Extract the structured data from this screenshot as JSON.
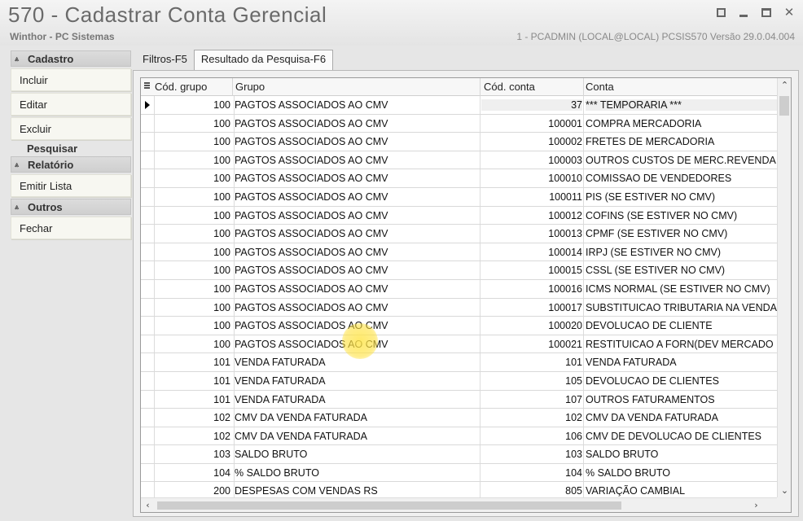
{
  "window": {
    "title": "570 - Cadastrar Conta Gerencial",
    "subtitle": "Winthor - PC Sistemas",
    "session_info": "1 - PCADMIN (LOCAL@LOCAL)   PCSIS570  Versão  29.0.04.004"
  },
  "sidebar": {
    "cadastro_header": "Cadastro",
    "incluir": "Incluir",
    "editar": "Editar",
    "excluir": "Excluir",
    "pesquisar": "Pesquisar",
    "relatorio_header": "Relatório",
    "emitir_lista": "Emitir Lista",
    "outros_header": "Outros",
    "fechar": "Fechar"
  },
  "tabs": {
    "filtros": "Filtros-F5",
    "resultado": "Resultado da Pesquisa-F6"
  },
  "grid": {
    "columns": {
      "cod_grupo": "Cód. grupo",
      "grupo": "Grupo",
      "cod_conta": "Cód. conta",
      "conta": "Conta"
    },
    "rows": [
      {
        "cod_grupo": "100",
        "grupo": "PAGTOS ASSOCIADOS AO CMV",
        "cod_conta": "37",
        "conta": "*** TEMPORARIA ***"
      },
      {
        "cod_grupo": "100",
        "grupo": "PAGTOS ASSOCIADOS AO CMV",
        "cod_conta": "100001",
        "conta": "COMPRA MERCADORIA"
      },
      {
        "cod_grupo": "100",
        "grupo": "PAGTOS ASSOCIADOS AO CMV",
        "cod_conta": "100002",
        "conta": "FRETES DE MERCADORIA"
      },
      {
        "cod_grupo": "100",
        "grupo": "PAGTOS ASSOCIADOS AO CMV",
        "cod_conta": "100003",
        "conta": "OUTROS CUSTOS DE MERC.REVENDA"
      },
      {
        "cod_grupo": "100",
        "grupo": "PAGTOS ASSOCIADOS AO CMV",
        "cod_conta": "100010",
        "conta": "COMISSAO DE VENDEDORES"
      },
      {
        "cod_grupo": "100",
        "grupo": "PAGTOS ASSOCIADOS AO CMV",
        "cod_conta": "100011",
        "conta": "PIS (SE ESTIVER NO CMV)"
      },
      {
        "cod_grupo": "100",
        "grupo": "PAGTOS ASSOCIADOS AO CMV",
        "cod_conta": "100012",
        "conta": "COFINS (SE ESTIVER NO CMV)"
      },
      {
        "cod_grupo": "100",
        "grupo": "PAGTOS ASSOCIADOS AO CMV",
        "cod_conta": "100013",
        "conta": "CPMF (SE ESTIVER NO CMV)"
      },
      {
        "cod_grupo": "100",
        "grupo": "PAGTOS ASSOCIADOS AO CMV",
        "cod_conta": "100014",
        "conta": "IRPJ (SE ESTIVER NO CMV)"
      },
      {
        "cod_grupo": "100",
        "grupo": "PAGTOS ASSOCIADOS AO CMV",
        "cod_conta": "100015",
        "conta": "CSSL (SE ESTIVER NO CMV)"
      },
      {
        "cod_grupo": "100",
        "grupo": "PAGTOS ASSOCIADOS AO CMV",
        "cod_conta": "100016",
        "conta": "ICMS NORMAL (SE ESTIVER NO CMV)"
      },
      {
        "cod_grupo": "100",
        "grupo": "PAGTOS ASSOCIADOS AO CMV",
        "cod_conta": "100017",
        "conta": "SUBSTITUICAO TRIBUTARIA NA VENDA"
      },
      {
        "cod_grupo": "100",
        "grupo": "PAGTOS ASSOCIADOS AO CMV",
        "cod_conta": "100020",
        "conta": "DEVOLUCAO DE CLIENTE"
      },
      {
        "cod_grupo": "100",
        "grupo": "PAGTOS ASSOCIADOS AO CMV",
        "cod_conta": "100021",
        "conta": "RESTITUICAO A FORN(DEV MERCADO"
      },
      {
        "cod_grupo": "101",
        "grupo": "VENDA FATURADA",
        "cod_conta": "101",
        "conta": "VENDA FATURADA"
      },
      {
        "cod_grupo": "101",
        "grupo": "VENDA FATURADA",
        "cod_conta": "105",
        "conta": "DEVOLUCAO DE CLIENTES"
      },
      {
        "cod_grupo": "101",
        "grupo": "VENDA FATURADA",
        "cod_conta": "107",
        "conta": "OUTROS FATURAMENTOS"
      },
      {
        "cod_grupo": "102",
        "grupo": "CMV DA VENDA FATURADA",
        "cod_conta": "102",
        "conta": "CMV DA VENDA FATURADA"
      },
      {
        "cod_grupo": "102",
        "grupo": "CMV DA VENDA FATURADA",
        "cod_conta": "106",
        "conta": "CMV DE DEVOLUCAO DE CLIENTES"
      },
      {
        "cod_grupo": "103",
        "grupo": "SALDO BRUTO",
        "cod_conta": "103",
        "conta": "SALDO BRUTO"
      },
      {
        "cod_grupo": "104",
        "grupo": "% SALDO BRUTO",
        "cod_conta": "104",
        "conta": "% SALDO BRUTO"
      },
      {
        "cod_grupo": "200",
        "grupo": "DESPESAS COM VENDAS RS",
        "cod_conta": "805",
        "conta": "VARIAÇÃO CAMBIAL"
      }
    ]
  }
}
